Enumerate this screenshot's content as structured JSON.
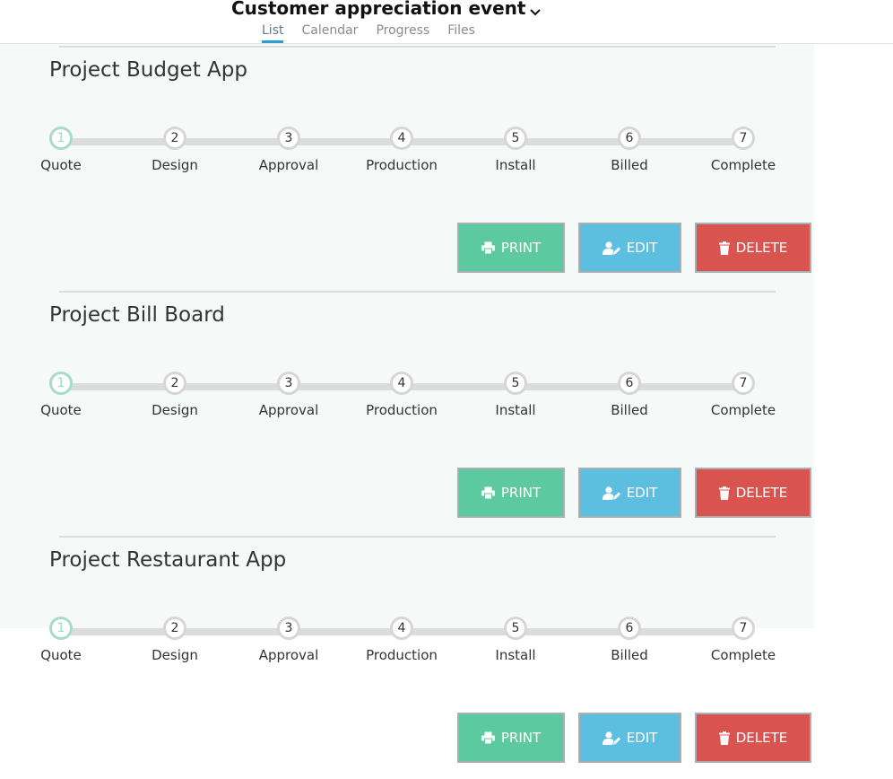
{
  "header": {
    "title": "Customer appreciation event",
    "tabs": [
      {
        "label": "List",
        "active": true
      },
      {
        "label": "Calendar",
        "active": false
      },
      {
        "label": "Progress",
        "active": false
      },
      {
        "label": "Files",
        "active": false
      }
    ]
  },
  "projects": [
    {
      "title": "Project Budget App",
      "steps": [
        {
          "number": "1",
          "label": "Quote",
          "current": true
        },
        {
          "number": "2",
          "label": "Design"
        },
        {
          "number": "3",
          "label": "Approval"
        },
        {
          "number": "4",
          "label": "Production"
        },
        {
          "number": "5",
          "label": "Install"
        },
        {
          "number": "6",
          "label": "Billed"
        },
        {
          "number": "7",
          "label": "Complete"
        }
      ],
      "buttons": {
        "print": "PRINT",
        "edit": "EDIT",
        "delete": "DELETE"
      }
    },
    {
      "title": "Project Bill Board",
      "steps": [
        {
          "number": "1",
          "label": "Quote",
          "current": true
        },
        {
          "number": "2",
          "label": "Design"
        },
        {
          "number": "3",
          "label": "Approval"
        },
        {
          "number": "4",
          "label": "Production"
        },
        {
          "number": "5",
          "label": "Install"
        },
        {
          "number": "6",
          "label": "Billed"
        },
        {
          "number": "7",
          "label": "Complete"
        }
      ],
      "buttons": {
        "print": "PRINT",
        "edit": "EDIT",
        "delete": "DELETE"
      }
    },
    {
      "title": "Project Restaurant App",
      "steps": [
        {
          "number": "1",
          "label": "Quote",
          "current": true
        },
        {
          "number": "2",
          "label": "Design"
        },
        {
          "number": "3",
          "label": "Approval"
        },
        {
          "number": "4",
          "label": "Production"
        },
        {
          "number": "5",
          "label": "Install"
        },
        {
          "number": "6",
          "label": "Billed"
        },
        {
          "number": "7",
          "label": "Complete"
        }
      ],
      "buttons": {
        "print": "PRINT",
        "edit": "EDIT",
        "delete": "DELETE"
      }
    }
  ],
  "colors": {
    "print_button": "#5dc9a0",
    "edit_button": "#5dbfe0",
    "delete_button": "#d9534f",
    "active_tab_underline": "#2a9fd6",
    "current_step_ring": "#a7dcc8"
  },
  "icons": {
    "print": "printer-icon",
    "edit": "user-edit-icon",
    "delete": "trash-icon",
    "title_caret": "chevron-down-icon"
  }
}
